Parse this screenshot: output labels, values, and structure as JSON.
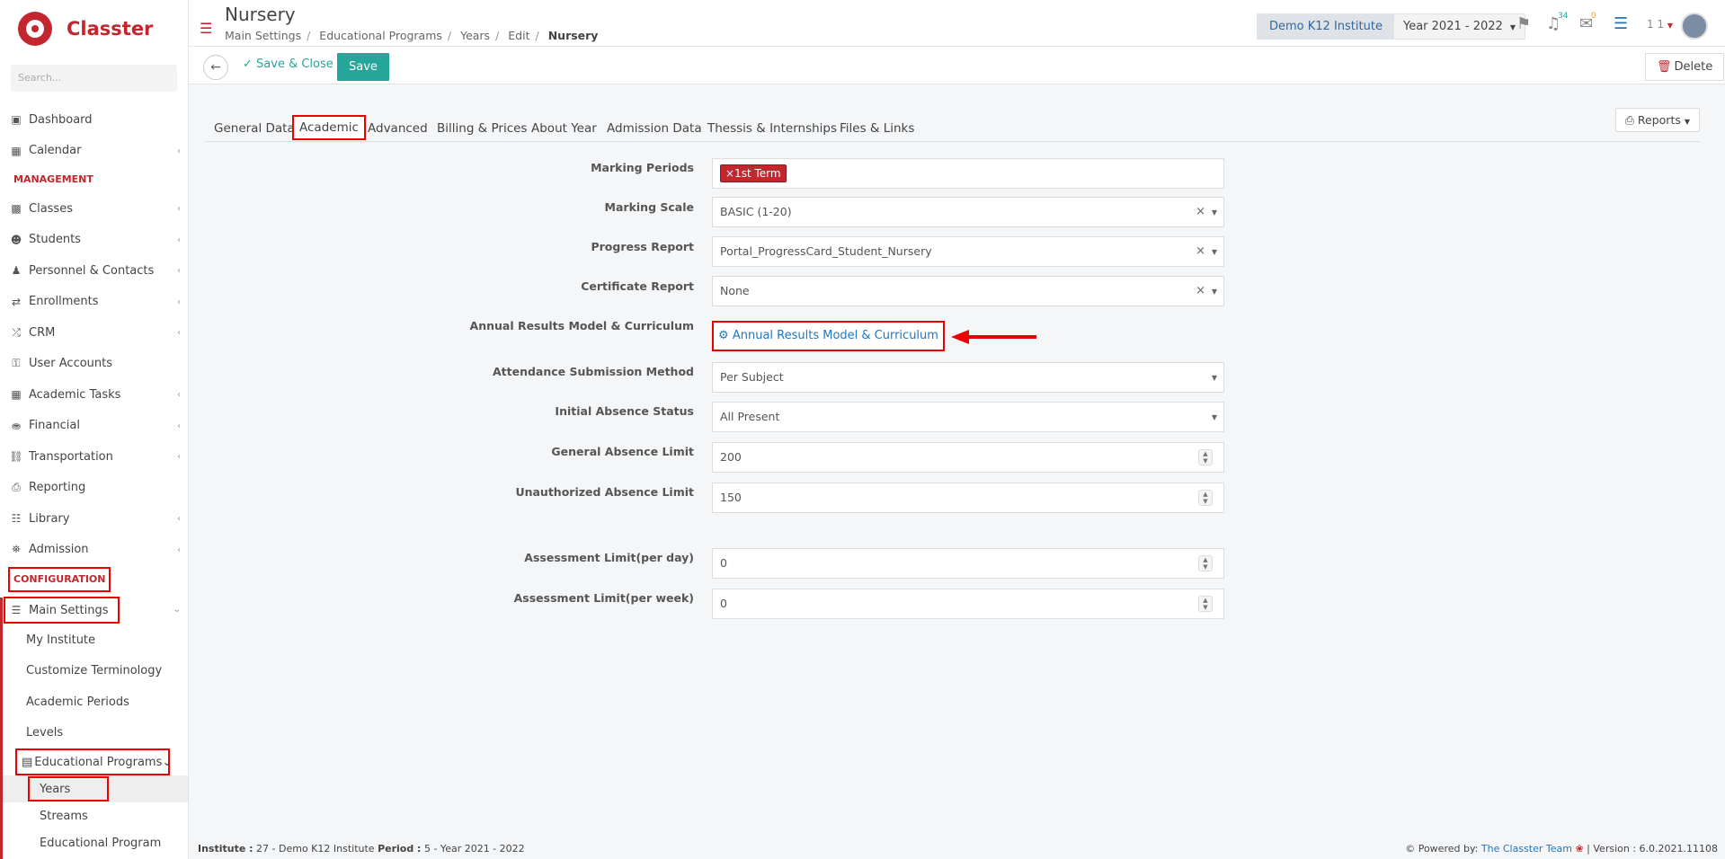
{
  "app": {
    "name": "Classter"
  },
  "sidebar": {
    "search_placeholder": "Search...",
    "items_top": [
      {
        "label": "Dashboard",
        "icon": "laptop-icon",
        "chevron": false
      },
      {
        "label": "Calendar",
        "icon": "calendar-icon",
        "chevron": true
      }
    ],
    "management_label": "MANAGEMENT",
    "items_management": [
      {
        "label": "Classes",
        "icon": "classes-icon",
        "chevron": true
      },
      {
        "label": "Students",
        "icon": "students-icon",
        "chevron": true
      },
      {
        "label": "Personnel & Contacts",
        "icon": "personnel-icon",
        "chevron": true
      },
      {
        "label": "Enrollments",
        "icon": "enrollments-icon",
        "chevron": true
      },
      {
        "label": "CRM",
        "icon": "crm-icon",
        "chevron": true
      },
      {
        "label": "User Accounts",
        "icon": "key-icon",
        "chevron": false
      },
      {
        "label": "Academic Tasks",
        "icon": "grid-icon",
        "chevron": true
      },
      {
        "label": "Financial",
        "icon": "coins-icon",
        "chevron": true
      },
      {
        "label": "Transportation",
        "icon": "bus-icon",
        "chevron": true
      },
      {
        "label": "Reporting",
        "icon": "printer-icon",
        "chevron": false
      },
      {
        "label": "Library",
        "icon": "library-icon",
        "chevron": true
      },
      {
        "label": "Admission",
        "icon": "bank-icon",
        "chevron": true
      }
    ],
    "configuration_label": "CONFIGURATION",
    "main_settings_label": "Main Settings",
    "main_settings_children": [
      "My Institute",
      "Customize Terminology",
      "Academic Periods",
      "Levels"
    ],
    "educational_programs_label": "Educational Programs",
    "educational_programs_children": [
      "Years",
      "Streams",
      "Educational Program"
    ]
  },
  "header": {
    "title": "Nursery",
    "breadcrumb": [
      "Main Settings",
      "Educational Programs",
      "Years",
      "Edit",
      "Nursery"
    ],
    "institute": "Demo K12 Institute",
    "year": "Year 2021 - 2022",
    "notifications_count": "34",
    "messages_count": "0",
    "user_label": "1 1"
  },
  "toolbar": {
    "save_close_label": "Save & Close",
    "save_label": "Save",
    "delete_label": "Delete"
  },
  "tabs": [
    "General Data",
    "Academic",
    "Advanced",
    "Billing & Prices",
    "About Year",
    "Admission Data",
    "Thessis & Internships",
    "Files & Links"
  ],
  "active_tab": "Academic",
  "reports_label": "Reports",
  "form": {
    "marking_periods": {
      "label": "Marking Periods",
      "tag": "×1st Term"
    },
    "marking_scale": {
      "label": "Marking Scale",
      "value": "BASIC (1-20)"
    },
    "progress_report": {
      "label": "Progress Report",
      "value": "Portal_ProgressCard_Student_Nursery"
    },
    "certificate_report": {
      "label": "Certificate Report",
      "value": "None"
    },
    "annual_results": {
      "label": "Annual Results Model & Curriculum",
      "button": "Annual Results Model & Curriculum"
    },
    "attendance_method": {
      "label": "Attendance Submission Method",
      "value": "Per Subject"
    },
    "initial_absence": {
      "label": "Initial Absence Status",
      "value": "All Present"
    },
    "general_absence_limit": {
      "label": "General Absence Limit",
      "value": "200"
    },
    "unauthorized_absence_limit": {
      "label": "Unauthorized Absence Limit",
      "value": "150"
    },
    "assessment_limit_day": {
      "label": "Assessment Limit(per day)",
      "value": "0"
    },
    "assessment_limit_week": {
      "label": "Assessment Limit(per week)",
      "value": "0"
    }
  },
  "footer": {
    "institute_label": "Institute :",
    "institute_value": "27 - Demo K12 Institute",
    "period_label": "Period :",
    "period_value": "5 - Year 2021 - 2022",
    "powered_by": "Powered by:",
    "team": "The Classter Team",
    "version": "| Version : 6.0.2021.11108"
  },
  "colors": {
    "brand": "#c2262e",
    "accent": "#26a69a",
    "link": "#2277bb",
    "highlight": "#ee0000"
  }
}
